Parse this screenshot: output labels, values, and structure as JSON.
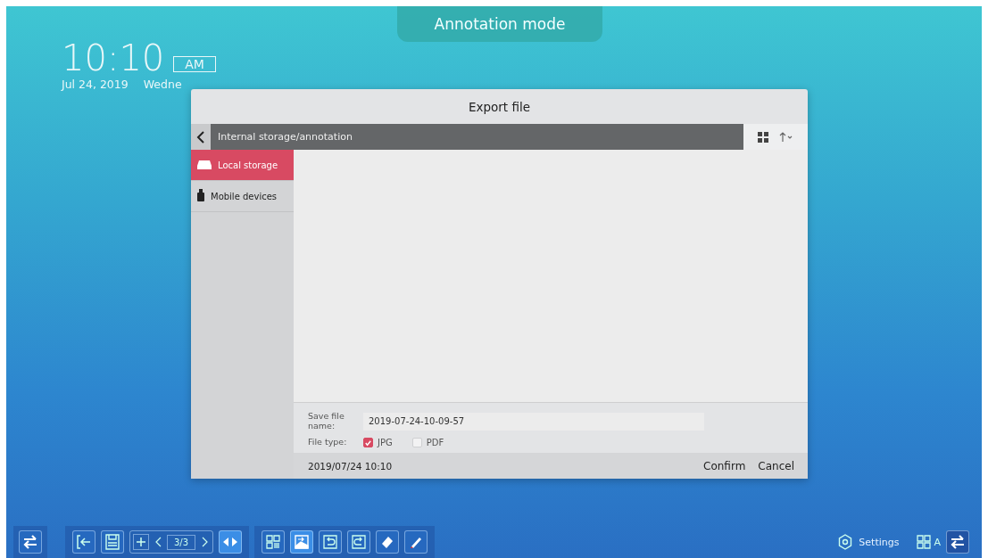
{
  "mode_banner": "Annotation mode",
  "clock": {
    "time": "10:10",
    "period": "AM",
    "date": "Jul 24, 2019",
    "weekday": "Wedne"
  },
  "dialog": {
    "title": "Export file",
    "path": "Internal storage/annotation",
    "sidebar": {
      "items": [
        {
          "label": "Local storage",
          "kind": "drive",
          "selected": true
        },
        {
          "label": "Mobile devices",
          "kind": "usb",
          "selected": false
        }
      ]
    },
    "form": {
      "name_label": "Save file name:",
      "name_value": "2019-07-24-10-09-57",
      "type_label": "File type:",
      "types": [
        {
          "label": "JPG",
          "checked": true
        },
        {
          "label": "PDF",
          "checked": false
        }
      ]
    },
    "footer": {
      "timestamp": "2019/07/24 10:10",
      "buttons": [
        "Confirm",
        "Cancel"
      ]
    }
  },
  "toolbar": {
    "page_indicator": "3/3",
    "left_tools": [
      {
        "kind": "exit",
        "selected": false
      },
      {
        "kind": "save",
        "selected": false
      }
    ],
    "nav_toggle": {
      "selected": true
    },
    "right_tools": [
      {
        "kind": "select",
        "selected": false
      },
      {
        "kind": "export",
        "selected": true
      },
      {
        "kind": "undo",
        "selected": false
      },
      {
        "kind": "redo",
        "selected": false
      },
      {
        "kind": "eraser",
        "selected": false
      },
      {
        "kind": "pen",
        "selected": false
      }
    ],
    "settings": "Settings",
    "apps": "A"
  }
}
